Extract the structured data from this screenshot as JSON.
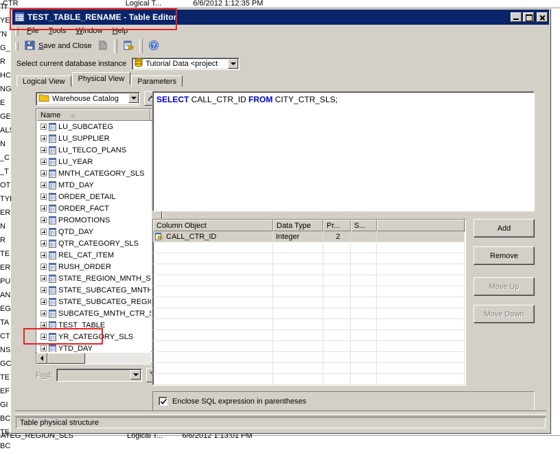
{
  "window": {
    "title": "TEST_TABLE_RENAME - Table Editor",
    "title_icon": "table-icon",
    "minimize": "_",
    "maximize": "□",
    "close": "×"
  },
  "menubar": {
    "items": [
      {
        "label": "File",
        "accel": "F"
      },
      {
        "label": "Tools",
        "accel": "T"
      },
      {
        "label": "Window",
        "accel": "W"
      },
      {
        "label": "Help",
        "accel": "H"
      }
    ]
  },
  "toolbar": {
    "save_and_close": "Save and Close",
    "save_icon": "floppy-disk-icon",
    "new_icon": "new-document-icon",
    "keys_icon": "clipboard-key-icon",
    "help_icon": "help-circle-icon"
  },
  "db_instance": {
    "label": "Select current database instance",
    "icon": "database-icon",
    "value": "Tutorial Data <project ",
    "arrow_icon": "chevron-down-icon"
  },
  "tabs": [
    {
      "label": "Logical View",
      "active": false
    },
    {
      "label": "Physical View",
      "active": true
    },
    {
      "label": "Parameters",
      "active": false
    }
  ],
  "catalog": {
    "folder_icon": "folder-icon",
    "value": "Warehouse Catalog",
    "arrow_icon": "chevron-down-icon",
    "up_button_icon": "go-up-icon"
  },
  "tree": {
    "header": "Name",
    "sort_icon": "sort-ascending-icon",
    "scroll_up_icon": "triangle-up-icon",
    "scroll_down_icon": "triangle-down-icon",
    "scroll_left_icon": "triangle-left-icon",
    "scroll_right_icon": "triangle-right-icon",
    "items": [
      {
        "label": "LU_SUBCATEG",
        "highlighted": false
      },
      {
        "label": "LU_SUPPLIER",
        "highlighted": false
      },
      {
        "label": "LU_TELCO_PLANS",
        "highlighted": false
      },
      {
        "label": "LU_YEAR",
        "highlighted": false
      },
      {
        "label": "MNTH_CATEGORY_SLS",
        "highlighted": false
      },
      {
        "label": "MTD_DAY",
        "highlighted": false
      },
      {
        "label": "ORDER_DETAIL",
        "highlighted": false
      },
      {
        "label": "ORDER_FACT",
        "highlighted": false
      },
      {
        "label": "PROMOTIONS",
        "highlighted": false
      },
      {
        "label": "QTD_DAY",
        "highlighted": false
      },
      {
        "label": "QTR_CATEGORY_SLS",
        "highlighted": false
      },
      {
        "label": "REL_CAT_ITEM",
        "highlighted": false
      },
      {
        "label": "RUSH_ORDER",
        "highlighted": false
      },
      {
        "label": "STATE_REGION_MNTH_SLS",
        "highlighted": false
      },
      {
        "label": "STATE_SUBCATEG_MNTH_S",
        "highlighted": false
      },
      {
        "label": "STATE_SUBCATEG_REGION",
        "highlighted": false
      },
      {
        "label": "SUBCATEG_MNTH_CTR_SL",
        "highlighted": false
      },
      {
        "label": "TEST_TABLE",
        "highlighted": true
      },
      {
        "label": "YR_CATEGORY_SLS",
        "highlighted": false
      },
      {
        "label": "YTD_DAY",
        "highlighted": false
      }
    ]
  },
  "find": {
    "label": "Find:",
    "value": "",
    "arrow_icon": "chevron-down-icon",
    "filter_icon": "funnel-icon"
  },
  "sql": {
    "keyword_1": "SELECT",
    "text_1": " CALL_CTR_ID ",
    "keyword_2": "FROM",
    "text_2": " CITY_CTR_SLS;"
  },
  "grid": {
    "columns": [
      "Column Object",
      "Data Type",
      "Pr...",
      "S...",
      ""
    ],
    "rows": [
      {
        "icon": "column-key-icon",
        "cells": [
          "CALL_CTR_ID",
          "Integer",
          "2",
          "",
          ""
        ]
      }
    ],
    "empty_row_count": 14
  },
  "buttons": [
    {
      "label": "Add",
      "enabled": true
    },
    {
      "label": "Remove",
      "enabled": true
    },
    {
      "label": "Move Up",
      "enabled": false
    },
    {
      "label": "Move Down",
      "enabled": false
    }
  ],
  "checkbox": {
    "label": "Enclose SQL expression in parentheses",
    "checked": true,
    "check_icon": "check-icon"
  },
  "statusbar": {
    "text": "Table physical structure"
  },
  "background": {
    "top_row": {
      "name": "CTR",
      "type": "Logical T...",
      "date": "6/6/2012 1:12:35 PM"
    },
    "bottom_row": {
      "name": "BCATEG_REGION_SLS",
      "type": "Logical T...",
      "date": "6/6/2012 1:13:01 PM"
    },
    "left_fragments": [
      "TI",
      "YEI",
      "'N",
      "G_",
      "R",
      "HC",
      "NG",
      "E",
      "GER",
      "ALS",
      "N",
      "_C",
      "_T",
      "OTI",
      "TYF",
      "ER",
      "N",
      "R",
      "TE",
      "ER",
      "PU",
      "AN",
      "EG",
      "TA",
      "CT",
      "NS",
      "GC",
      "TE",
      "EF",
      "GI",
      "BC",
      "TE",
      "BC"
    ]
  },
  "colors": {
    "titlebar": "#0a246a",
    "face": "#d4d0c8",
    "annotation": "#e8231f",
    "keyword": "#0000cc"
  }
}
